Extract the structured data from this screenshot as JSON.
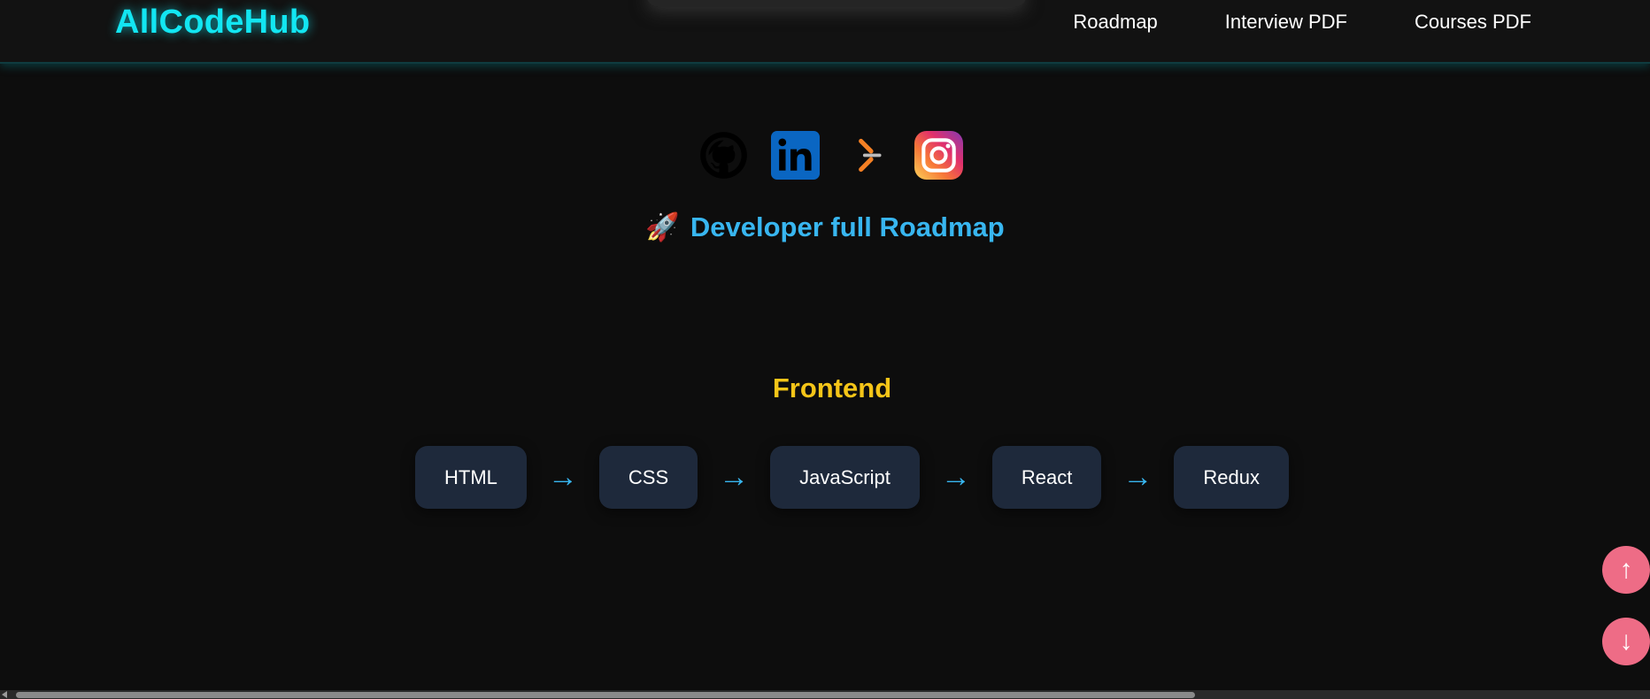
{
  "header": {
    "logo": "AllCodeHub",
    "nav": [
      {
        "label": "Roadmap"
      },
      {
        "label": "Interview PDF"
      },
      {
        "label": "Courses PDF"
      }
    ]
  },
  "socials": [
    {
      "name": "github-icon"
    },
    {
      "name": "linkedin-icon"
    },
    {
      "name": "stackoverflow-icon"
    },
    {
      "name": "instagram-icon"
    }
  ],
  "hero": {
    "emoji": "🚀",
    "title": "Developer full Roadmap"
  },
  "section": {
    "title": "Frontend",
    "nodes": [
      "HTML",
      "CSS",
      "JavaScript",
      "React",
      "Redux"
    ],
    "arrow": "→"
  },
  "fab": {
    "up": "↑",
    "down": "↓"
  },
  "colors": {
    "background": "#0d0d0d",
    "logo": "#12e6f2",
    "title": "#38b6f0",
    "section_title": "#f5c518",
    "node_bg": "#1e293b",
    "fab": "#ee6c86"
  }
}
